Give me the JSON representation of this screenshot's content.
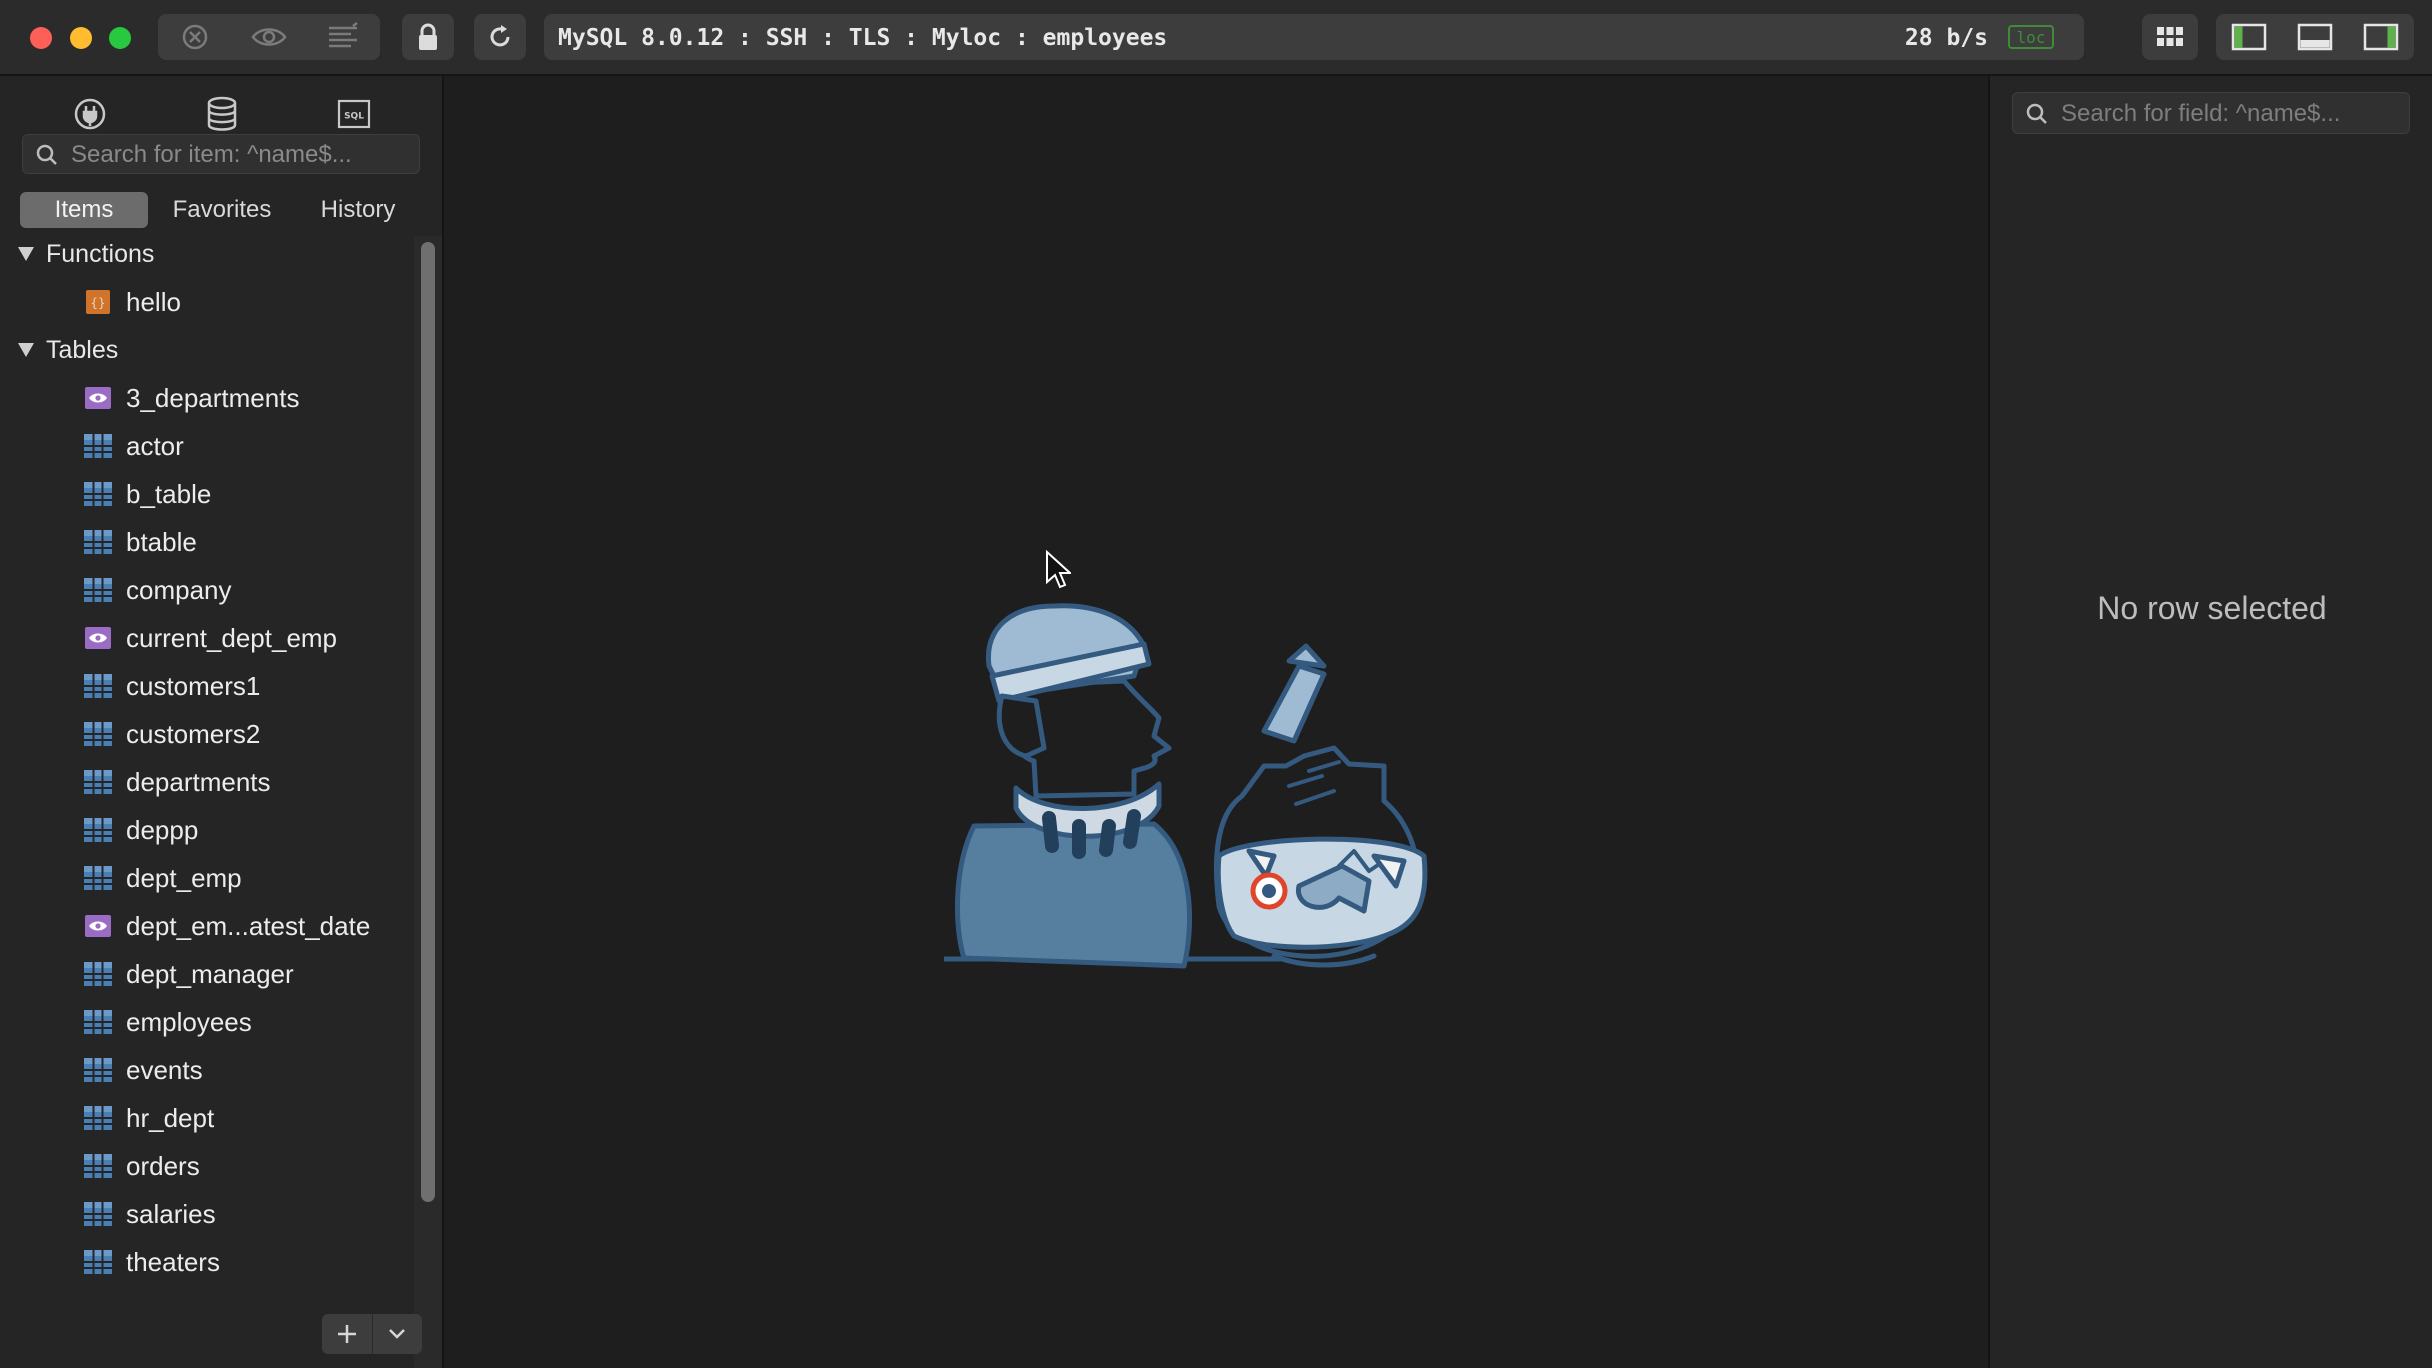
{
  "titlebar": {
    "connection": "MySQL 8.0.12 : SSH : TLS : Myloc : employees",
    "speed": "28 b/s",
    "badge": "loc",
    "buttons": [
      "close-circle-icon",
      "eye-icon",
      "lines-icon"
    ],
    "layout_buttons": [
      "left-panel-icon",
      "bottom-panel-icon",
      "right-panel-icon"
    ]
  },
  "sidebar": {
    "search_placeholder": "Search for item: ^name$...",
    "segments": [
      "Items",
      "Favorites",
      "History"
    ],
    "groups": [
      {
        "label": "Functions",
        "items": [
          {
            "name": "hello",
            "kind": "function"
          }
        ]
      },
      {
        "label": "Tables",
        "items": [
          {
            "name": "3_departments",
            "kind": "view"
          },
          {
            "name": "actor",
            "kind": "table"
          },
          {
            "name": "b_table",
            "kind": "table"
          },
          {
            "name": "btable",
            "kind": "table"
          },
          {
            "name": "company",
            "kind": "table"
          },
          {
            "name": "current_dept_emp",
            "kind": "view"
          },
          {
            "name": "customers1",
            "kind": "table"
          },
          {
            "name": "customers2",
            "kind": "table"
          },
          {
            "name": "departments",
            "kind": "table"
          },
          {
            "name": "deppp",
            "kind": "table"
          },
          {
            "name": "dept_emp",
            "kind": "table"
          },
          {
            "name": "dept_em...atest_date",
            "kind": "view"
          },
          {
            "name": "dept_manager",
            "kind": "table"
          },
          {
            "name": "employees",
            "kind": "table"
          },
          {
            "name": "events",
            "kind": "table"
          },
          {
            "name": "hr_dept",
            "kind": "table"
          },
          {
            "name": "orders",
            "kind": "table"
          },
          {
            "name": "salaries",
            "kind": "table"
          },
          {
            "name": "theaters",
            "kind": "table"
          }
        ]
      }
    ]
  },
  "rightpanel": {
    "search_placeholder": "Search for field: ^name$...",
    "empty_text": "No row selected"
  },
  "colors": {
    "view_icon": "#9b6cc4",
    "table_icon": "#4a7fb5",
    "function_icon": "#d0742c",
    "illustration": "#6d8fb0"
  }
}
